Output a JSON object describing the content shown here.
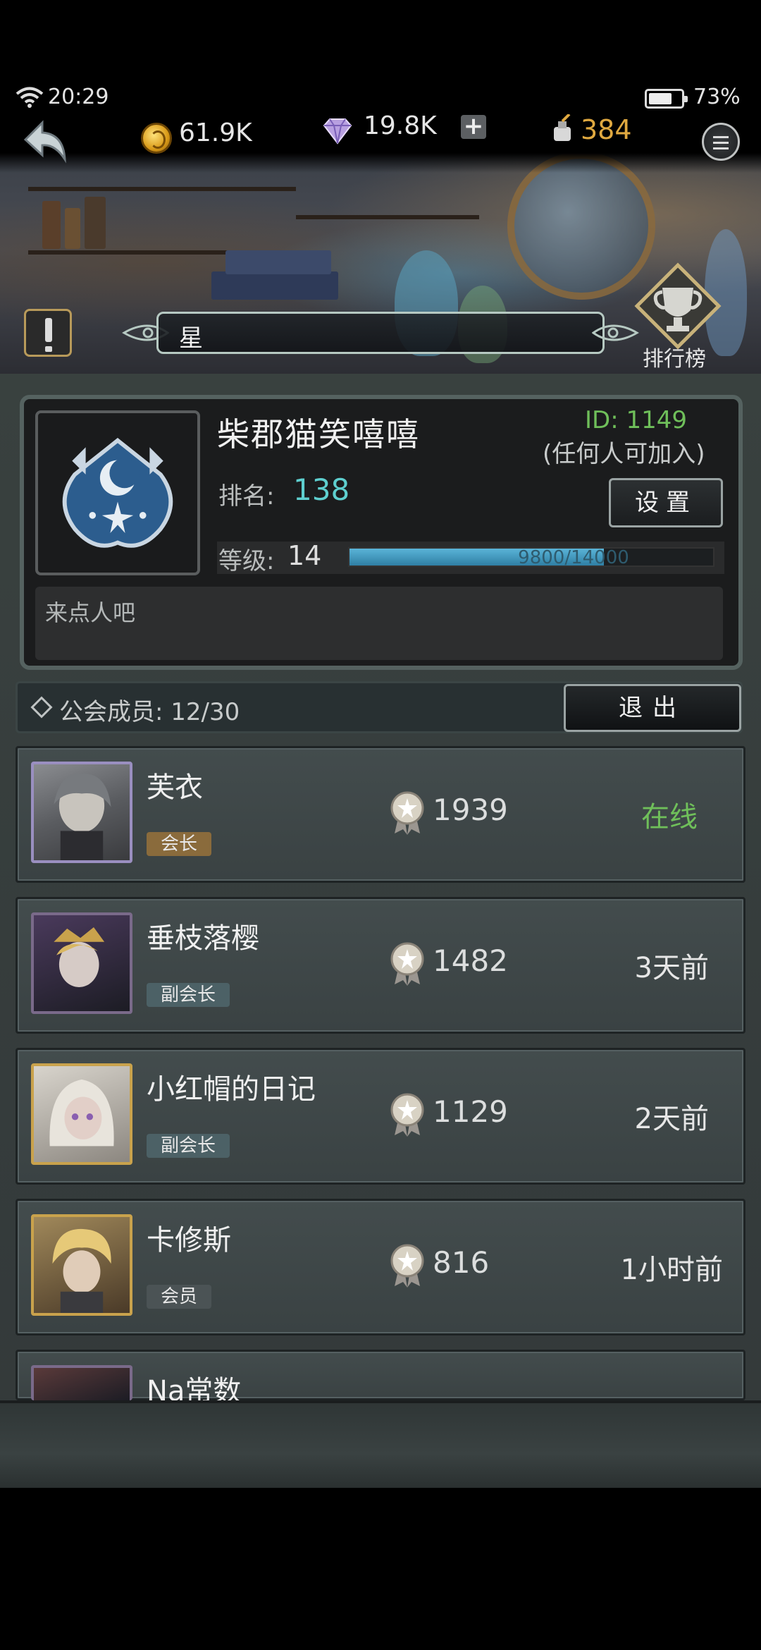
{
  "status_bar": {
    "time": "20:29",
    "battery_pct": "73%",
    "battery_level": 0.73
  },
  "currencies": {
    "gold": "61.9K",
    "gems": "19.8K",
    "add": "+",
    "ink": "384",
    "ink_color": "#e0a940"
  },
  "guild_short_name": "星",
  "ranking_label": "排行榜",
  "guild": {
    "name": "柴郡猫笑嘻嘻",
    "id": "ID: 1149",
    "join_policy": "(任何人可加入)",
    "rank_label": "排名:",
    "rank": "138",
    "level_label": "等级:",
    "level": "14",
    "xp_text": "9800/14000",
    "xp_current": 9800,
    "xp_max": 14000,
    "settings_label": "设置",
    "announcement": "来点人吧"
  },
  "members_bar": {
    "label": "公会成员: 12/30",
    "exit_label": "退出"
  },
  "members": [
    {
      "name": "芙衣",
      "role": "会长",
      "score": "1939",
      "status": "在线"
    },
    {
      "name": "垂枝落樱",
      "role": "副会长",
      "score": "1482",
      "status": "3天前"
    },
    {
      "name": "小红帽的日记",
      "role": "副会长",
      "score": "1129",
      "status": "2天前"
    },
    {
      "name": "卡修斯",
      "role": "会员",
      "score": "816",
      "status": "1小时前"
    },
    {
      "name": "Na常数"
    }
  ],
  "colors": {
    "online": "#6fbf5a",
    "rank": "#5ecfcf",
    "accent_gold": "#b99a5f"
  }
}
